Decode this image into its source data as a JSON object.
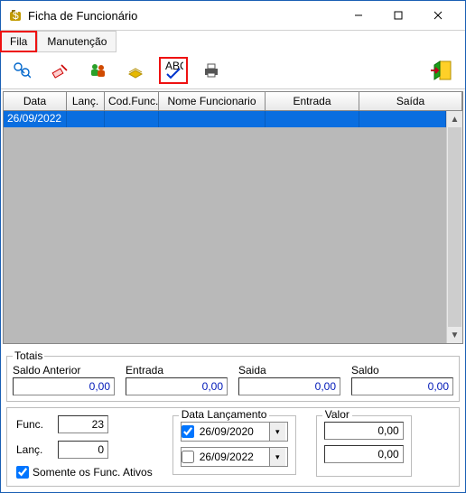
{
  "window": {
    "title": "Ficha de Funcionário"
  },
  "menu": {
    "fila": "Fila",
    "manutencao": "Manutenção"
  },
  "grid": {
    "headers": {
      "data": "Data",
      "lanc": "Lanç.",
      "cod": "Cod.Func.",
      "nome": "Nome Funcionario",
      "entrada": "Entrada",
      "saida": "Saída"
    },
    "row0": {
      "data": "26/09/2022",
      "lanc": "",
      "cod": "",
      "nome": "",
      "entrada": "",
      "saida": ""
    }
  },
  "totais": {
    "legend": "Totais",
    "saldo_ant_lab": "Saldo Anterior",
    "entrada_lab": "Entrada",
    "saida_lab": "Saida",
    "saldo_lab": "Saldo",
    "saldo_ant": "0,00",
    "entrada": "0,00",
    "saida": "0,00",
    "saldo": "0,00"
  },
  "bottom": {
    "func_lab": "Func.",
    "func": "23",
    "lanc_lab": "Lanç.",
    "lanc": "0",
    "somente_ativos": "Somente os Func. Ativos",
    "data_lanc_title": "Data Lançamento",
    "date1": "26/09/2020",
    "date2": "26/09/2022",
    "valor_title": "Valor",
    "valor1": "0,00",
    "valor2": "0,00"
  }
}
